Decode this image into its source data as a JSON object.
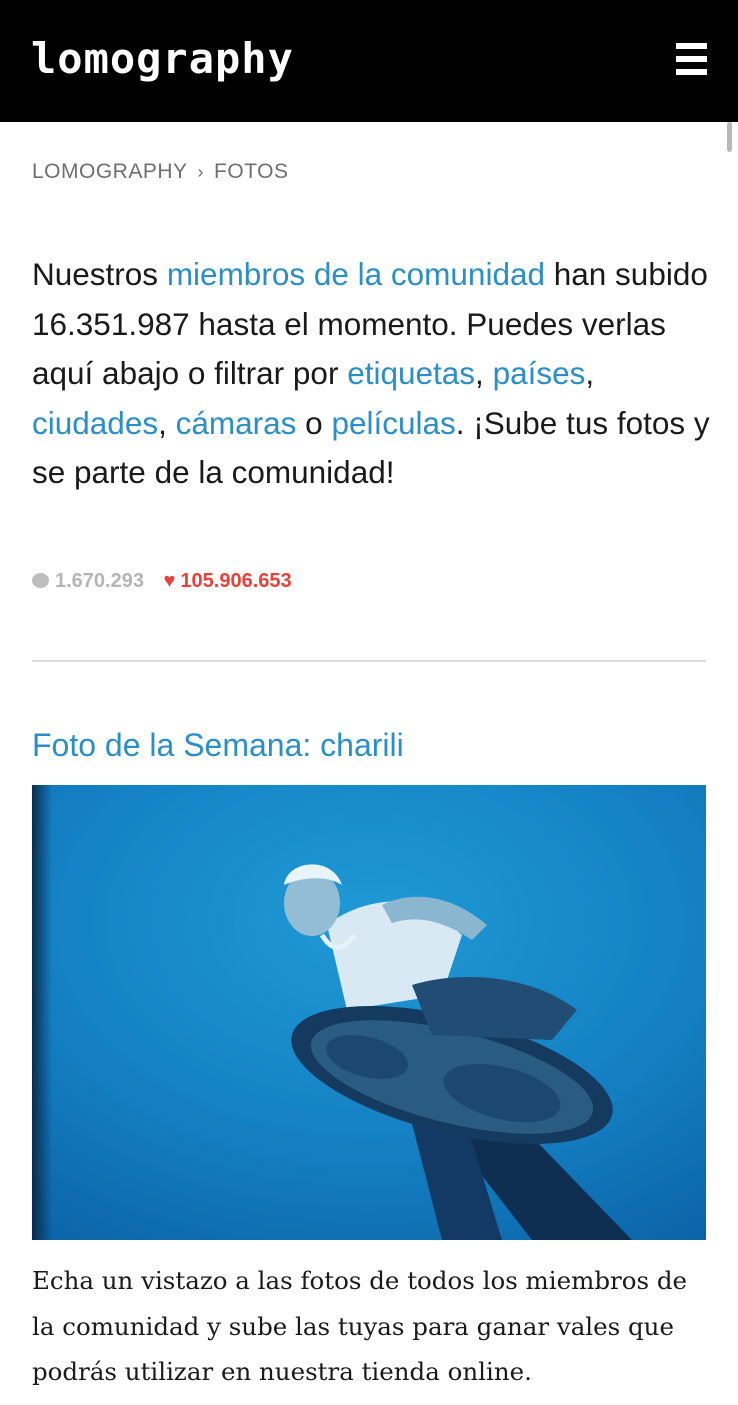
{
  "header": {
    "logo_text": "lomography",
    "menu_icon": "hamburger-menu-icon"
  },
  "breadcrumb": {
    "items": [
      "LOMOGRAPHY",
      "FOTOS"
    ],
    "separator": "›"
  },
  "intro": {
    "part1": "Nuestros ",
    "link_members": "miembros de la comunidad",
    "part2": " han subido 16.351.987 hasta el momento. Puedes verlas aquí abajo o filtrar por ",
    "link_tags": "etiquetas",
    "comma1": ", ",
    "link_countries": "países",
    "comma2": ", ",
    "link_cities": "ciudades",
    "comma3": ", ",
    "link_cameras": "cámaras",
    "part3": " o ",
    "link_films": "películas",
    "part4": ". ¡Sube tus fotos y se parte de la comunidad!"
  },
  "stats": {
    "comments": "1.670.293",
    "likes": "105.906.653"
  },
  "featured": {
    "title": "Foto de la Semana: charili",
    "caption": "Echa un vistazo a las fotos de todos los miembros de la comunidad y sube las tuyas para ganar vales que podrás utilizar en nuestra tienda online."
  },
  "colors": {
    "link": "#2a8fc9",
    "heart": "#e8423a",
    "header_bg": "#000000"
  }
}
